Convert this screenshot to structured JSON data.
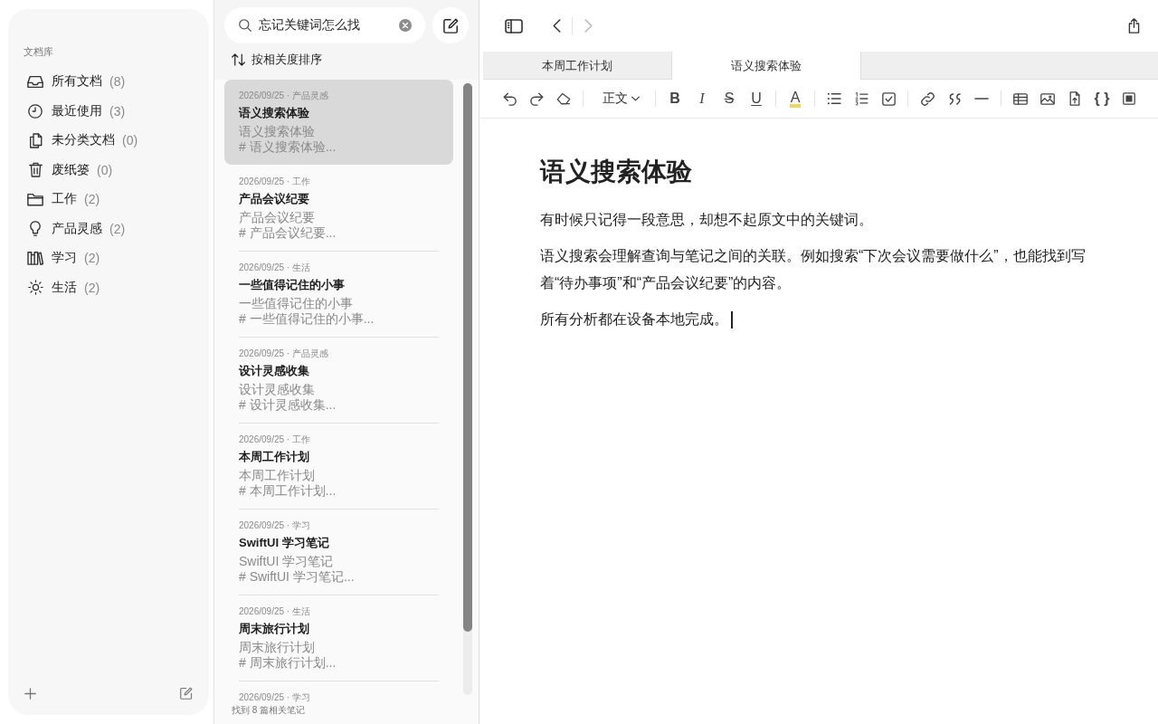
{
  "sidebar": {
    "section_label": "文档库",
    "items": [
      {
        "kind": "all",
        "label": "所有文档",
        "count": "(8)"
      },
      {
        "kind": "recent",
        "label": "最近使用",
        "count": "(3)"
      },
      {
        "kind": "unfiled",
        "label": "未分类文档",
        "count": "(0)"
      },
      {
        "kind": "trash",
        "label": "废纸篓",
        "count": "(0)"
      },
      {
        "kind": "work",
        "label": "工作",
        "count": "(2)"
      },
      {
        "kind": "idea",
        "label": "产品灵感",
        "count": "(2)"
      },
      {
        "kind": "study",
        "label": "学习",
        "count": "(2)"
      },
      {
        "kind": "life",
        "label": "生活",
        "count": "(2)"
      }
    ]
  },
  "note_list": {
    "search": {
      "value": "忘记关键词怎么找"
    },
    "sort": {
      "label": "按相关度排序"
    },
    "notes": [
      {
        "meta": "2026/09/25 · 产品灵感",
        "title": "语义搜索体验",
        "preview": "语义搜索体验",
        "excerpt": "# 语义搜索体验...",
        "selected": true
      },
      {
        "meta": "2026/09/25 · 工作",
        "title": "产品会议纪要",
        "preview": "产品会议纪要",
        "excerpt": "# 产品会议纪要...",
        "selected": false
      },
      {
        "meta": "2026/09/25 · 生活",
        "title": "一些值得记住的小事",
        "preview": "一些值得记住的小事",
        "excerpt": "# 一些值得记住的小事...",
        "selected": false
      },
      {
        "meta": "2026/09/25 · 产品灵感",
        "title": "设计灵感收集",
        "preview": "设计灵感收集",
        "excerpt": "# 设计灵感收集...",
        "selected": false
      },
      {
        "meta": "2026/09/25 · 工作",
        "title": "本周工作计划",
        "preview": "本周工作计划",
        "excerpt": "# 本周工作计划...",
        "selected": false
      },
      {
        "meta": "2026/09/25 · 学习",
        "title": "SwiftUI 学习笔记",
        "preview": "SwiftUI 学习笔记",
        "excerpt": "# SwiftUI 学习笔记...",
        "selected": false
      },
      {
        "meta": "2026/09/25 · 生活",
        "title": "周末旅行计划",
        "preview": "周末旅行计划",
        "excerpt": "# 周末旅行计划...",
        "selected": false
      },
      {
        "meta": "2026/09/25 · 学习",
        "selected": false
      }
    ],
    "footer": "找到 8 篇相关笔记"
  },
  "editor": {
    "nav": [
      {
        "kind": "back",
        "disabled": false
      },
      {
        "kind": "forward",
        "disabled": true
      }
    ],
    "tabs": [
      {
        "label": "本周工作计划",
        "selected": false
      },
      {
        "label": "语义搜索体验",
        "selected": true
      }
    ],
    "toolbar": {
      "style_menu": "正文",
      "format_buttons": [
        {
          "kind": "bold",
          "label": "B"
        },
        {
          "kind": "italic",
          "label": "I"
        },
        {
          "kind": "strike",
          "label": "S"
        },
        {
          "kind": "underline",
          "label": "U"
        }
      ],
      "highlight": "A",
      "code": "{ }"
    },
    "document": {
      "title": "语义搜索体验",
      "paragraphs": [
        "有时候只记得一段意思，却想不起原文中的关键词。",
        "语义搜索会理解查询与笔记之间的关联。例如搜索“下次会议需要做什么”，也能找到写着“待办事项”和“产品会议纪要”的内容。",
        "所有分析都在设备本地完成。"
      ]
    }
  }
}
